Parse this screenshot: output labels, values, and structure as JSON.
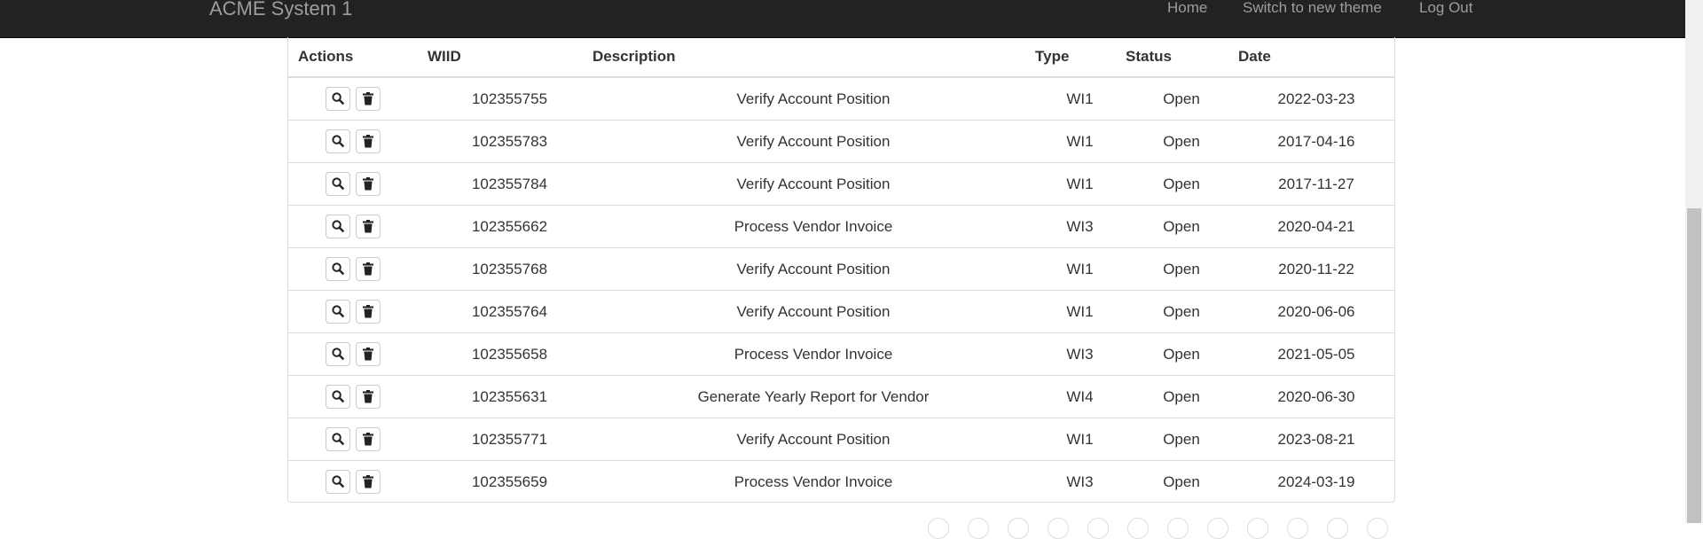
{
  "navbar": {
    "brand": "ACME System 1",
    "links": [
      {
        "label": "Home"
      },
      {
        "label": "Switch to new theme"
      },
      {
        "label": "Log Out"
      }
    ]
  },
  "table": {
    "headers": [
      "Actions",
      "WIID",
      "Description",
      "Type",
      "Status",
      "Date"
    ],
    "rows": [
      {
        "wiid": "102355755",
        "description": "Verify Account Position",
        "type": "WI1",
        "status": "Open",
        "date": "2022-03-23"
      },
      {
        "wiid": "102355783",
        "description": "Verify Account Position",
        "type": "WI1",
        "status": "Open",
        "date": "2017-04-16"
      },
      {
        "wiid": "102355784",
        "description": "Verify Account Position",
        "type": "WI1",
        "status": "Open",
        "date": "2017-11-27"
      },
      {
        "wiid": "102355662",
        "description": "Process Vendor Invoice",
        "type": "WI3",
        "status": "Open",
        "date": "2020-04-21"
      },
      {
        "wiid": "102355768",
        "description": "Verify Account Position",
        "type": "WI1",
        "status": "Open",
        "date": "2020-11-22"
      },
      {
        "wiid": "102355764",
        "description": "Verify Account Position",
        "type": "WI1",
        "status": "Open",
        "date": "2020-06-06"
      },
      {
        "wiid": "102355658",
        "description": "Process Vendor Invoice",
        "type": "WI3",
        "status": "Open",
        "date": "2021-05-05"
      },
      {
        "wiid": "102355631",
        "description": "Generate Yearly Report for Vendor",
        "type": "WI4",
        "status": "Open",
        "date": "2020-06-30"
      },
      {
        "wiid": "102355771",
        "description": "Verify Account Position",
        "type": "WI1",
        "status": "Open",
        "date": "2023-08-21"
      },
      {
        "wiid": "102355659",
        "description": "Process Vendor Invoice",
        "type": "WI3",
        "status": "Open",
        "date": "2024-03-19"
      }
    ],
    "row_actions": [
      "search-icon",
      "trash-icon"
    ]
  },
  "colors": {
    "navbar_bg": "#222222",
    "navbar_text": "#9d9d9d",
    "border": "#dddddd"
  }
}
